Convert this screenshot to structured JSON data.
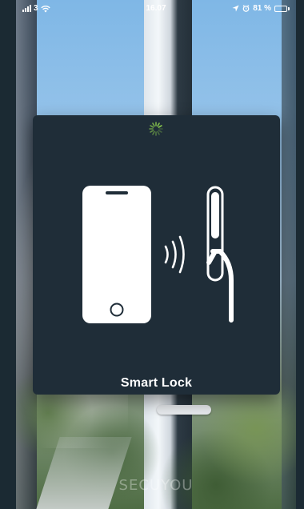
{
  "status_bar": {
    "carrier": "3",
    "time": "16.07",
    "battery_percent": "81 %",
    "battery_level": 0.81,
    "icons": [
      "signal-bars-icon",
      "wifi-icon",
      "location-arrow-icon",
      "alarm-icon",
      "battery-icon"
    ]
  },
  "modal": {
    "title": "Smart Lock",
    "spinner_color": "#8fd14f",
    "icons": [
      "loading-spinner-icon",
      "smartphone-icon",
      "wireless-signal-icon",
      "window-handle-icon"
    ]
  },
  "brand": {
    "name": "SECUYOU"
  },
  "colors": {
    "card_bg": "#1f2d38",
    "foreground": "#ffffff"
  }
}
